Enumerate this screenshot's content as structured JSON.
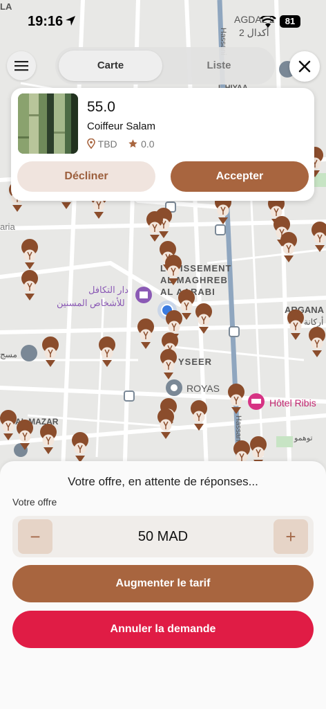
{
  "status_bar": {
    "time": "19:16",
    "battery": "81"
  },
  "map": {
    "labels": [
      "LA",
      "AGDAL 2",
      "أكدال 2",
      "Hassani",
      "aria",
      "LOTISSEMENT",
      "AL MAGHREB",
      "AL AARABI",
      "دار التكافل",
      "للأشخاص المسنين",
      "ARGANA",
      "أركانة",
      "YSEER",
      "ROYAS",
      "Hôtel Ribis",
      "AL MAZAR",
      "توهمو",
      "Hassan",
      "مسج",
      "L HIYAA"
    ]
  },
  "header": {
    "tabs": [
      {
        "label": "Carte"
      },
      {
        "label": "Liste"
      }
    ]
  },
  "offer_card": {
    "price": "55.0",
    "name": "Coiffeur Salam",
    "location": "TBD",
    "rating": "0.0",
    "decline_label": "Décliner",
    "accept_label": "Accepter"
  },
  "sheet": {
    "title": "Votre offre, en attente de réponses...",
    "offer_label": "Votre offre",
    "minus": "−",
    "plus": "+",
    "amount": "50 MAD",
    "increase_label": "Augmenter le tarif",
    "cancel_label": "Annuler la demande"
  },
  "colors": {
    "accent_brown": "#a8653f",
    "danger_red": "#e01c45",
    "pin_brown": "#8b4d2c"
  }
}
